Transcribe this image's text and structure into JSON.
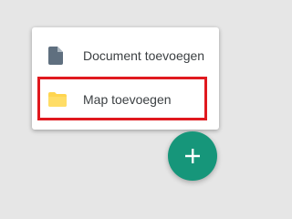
{
  "menu": {
    "items": [
      {
        "label": "Document toevoegen",
        "icon": "document-icon",
        "icon_color": "#5f6f7f"
      },
      {
        "label": "Map toevoegen",
        "icon": "folder-icon",
        "icon_color": "#ffd54f",
        "highlighted": true
      }
    ]
  },
  "fab": {
    "icon": "plus-icon",
    "color": "#16967a"
  },
  "highlight_color": "#e0191f"
}
